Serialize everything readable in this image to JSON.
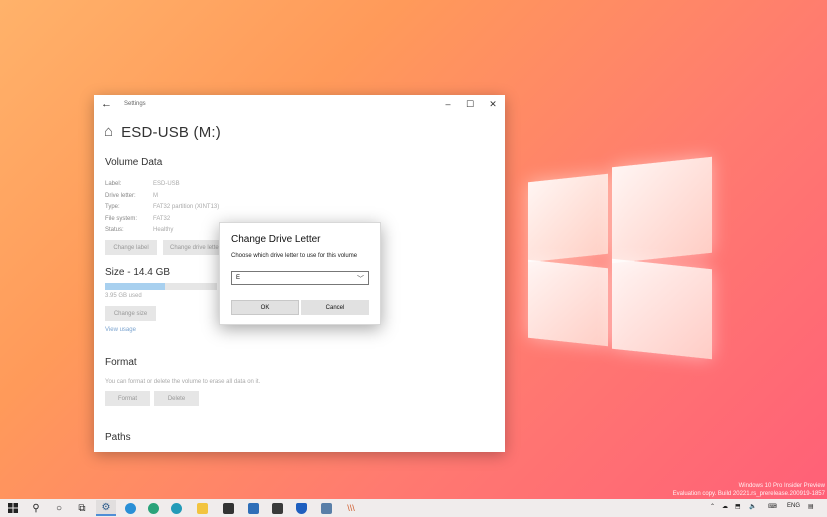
{
  "desktop": {
    "watermark": {
      "line1": "Windows 10 Pro Insider Preview",
      "line2": "Evaluation copy. Build 20221.rs_prerelease.200919-1857"
    }
  },
  "window": {
    "title": "Settings",
    "page_title": "ESD-USB (M:)",
    "volume_section": {
      "title": "Volume Data",
      "rows": [
        {
          "key": "Label:",
          "value": "ESD-USB"
        },
        {
          "key": "Drive letter:",
          "value": "M"
        },
        {
          "key": "Type:",
          "value": "FAT32 partition (XINT13)"
        },
        {
          "key": "File system:",
          "value": "FAT32"
        },
        {
          "key": "Status:",
          "value": "Healthy"
        }
      ],
      "change_label_button": "Change label",
      "change_drive_button": "Change drive letter"
    },
    "size_section": {
      "title": "Size - 14.4 GB",
      "used_text": "3.95 GB used",
      "used_fraction": 0.54,
      "change_size_button": "Change size",
      "view_usage_link": "View usage"
    },
    "format_section": {
      "title": "Format",
      "description": "You can format or delete the volume to erase all data on it.",
      "format_button": "Format",
      "delete_button": "Delete"
    },
    "paths_section": {
      "title": "Paths"
    }
  },
  "dialog": {
    "title": "Change Drive Letter",
    "description": "Choose which drive letter to use for this volume",
    "selected_letter": "E",
    "ok_button": "OK",
    "cancel_button": "Cancel"
  },
  "taskbar": {
    "language": "ENG"
  },
  "colors": {
    "accent": "#4f8ed6",
    "usage_bar": "#a8d0ef"
  }
}
